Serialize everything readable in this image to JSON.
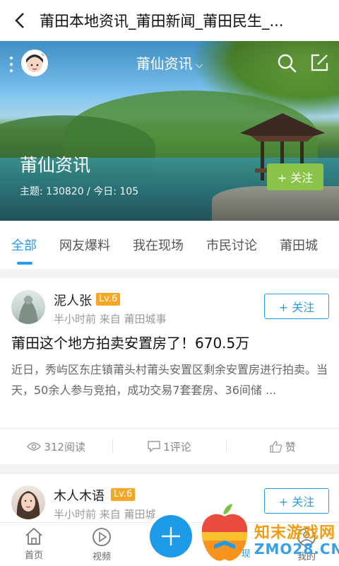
{
  "header": {
    "title": "莆田本地资讯_莆田新闻_莆田民生_..."
  },
  "hero": {
    "channel_name": "莆仙资讯",
    "forum_name": "莆仙资讯",
    "stats": "主题: 130820  /  今日: 105",
    "follow_label": "+ 关注"
  },
  "tabs": [
    {
      "label": "全部",
      "active": true
    },
    {
      "label": "网友爆料"
    },
    {
      "label": "我在现场"
    },
    {
      "label": "市民讨论"
    },
    {
      "label": "莆田城"
    }
  ],
  "posts": [
    {
      "author": "泥人张",
      "level": "Lv.6",
      "meta": "半小时前  来自 莆田城事",
      "follow_label": "+ 关注",
      "title": "莆田这个地方拍卖安置房了！670.5万",
      "excerpt": "近日，秀屿区东庄镇莆头村莆头安置区剩余安置房进行拍卖。当天，50余人参与竞拍，成功交易7套套房、36间储 ...",
      "views": "312阅读",
      "comments": "1评论",
      "like_label": "赞"
    },
    {
      "author": "木人木语",
      "level": "Lv.6",
      "meta": "半小时前  来自 莆田城",
      "follow_label": "+ 关注"
    }
  ],
  "bottom_nav": [
    {
      "label": "首页",
      "icon": "home-icon"
    },
    {
      "label": "视频",
      "icon": "play-icon"
    },
    {
      "label": "现",
      "icon": "discover-icon"
    },
    {
      "label": "我的",
      "icon": "user-icon"
    }
  ],
  "watermark": {
    "line1": "知末游戏网",
    "line2": "ZMO28.CN"
  },
  "colors": {
    "accent": "#2a9be8",
    "follow_green": "#8bc34a",
    "level_badge": "#f5a623"
  }
}
